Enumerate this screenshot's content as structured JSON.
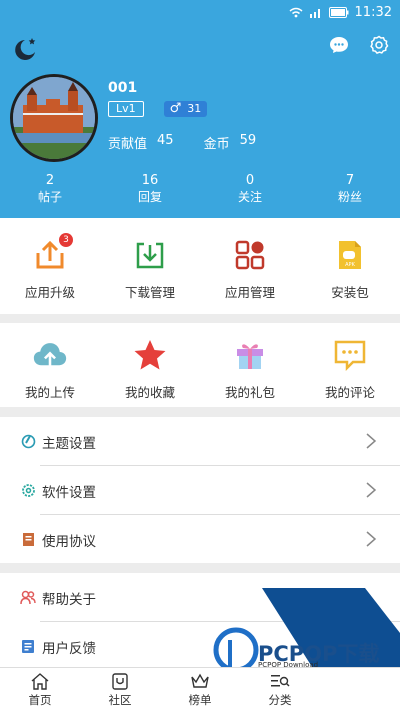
{
  "status": {
    "time": "11:32"
  },
  "profile": {
    "username": "001",
    "level": "Lv1",
    "gender_symbol": "♂",
    "gender_count": "31",
    "contribution_label": "贡献值",
    "contribution_value": "45",
    "coins_label": "金币",
    "coins_value": "59"
  },
  "stats": [
    {
      "value": "2",
      "label": "帖子"
    },
    {
      "value": "16",
      "label": "回复"
    },
    {
      "value": "0",
      "label": "关注"
    },
    {
      "value": "7",
      "label": "粉丝"
    }
  ],
  "grid1": [
    {
      "label": "应用升级",
      "icon": "upgrade-icon",
      "badge": "3"
    },
    {
      "label": "下载管理",
      "icon": "download-icon"
    },
    {
      "label": "应用管理",
      "icon": "apps-icon"
    },
    {
      "label": "安装包",
      "icon": "apk-icon"
    }
  ],
  "grid2": [
    {
      "label": "我的上传",
      "icon": "upload-cloud-icon"
    },
    {
      "label": "我的收藏",
      "icon": "star-icon"
    },
    {
      "label": "我的礼包",
      "icon": "gift-icon"
    },
    {
      "label": "我的评论",
      "icon": "comment-icon"
    }
  ],
  "settings": [
    {
      "label": "主题设置",
      "icon": "palette-icon"
    },
    {
      "label": "软件设置",
      "icon": "gear-icon"
    },
    {
      "label": "使用协议",
      "icon": "document-icon"
    }
  ],
  "more": [
    {
      "label": "帮助关于",
      "icon": "people-icon"
    },
    {
      "label": "用户反馈",
      "icon": "feedback-icon"
    }
  ],
  "nav": [
    {
      "label": "首页",
      "icon": "home-icon"
    },
    {
      "label": "社区",
      "icon": "community-icon"
    },
    {
      "label": "榜单",
      "icon": "crown-icon"
    },
    {
      "label": "分类",
      "icon": "category-icon"
    }
  ],
  "watermark": {
    "brand": "PCPOP下载",
    "sub": "PCPOP Download"
  },
  "colors": {
    "header": "#3aa6de",
    "accent_red": "#e53935",
    "green": "#2e9e4a",
    "orange": "#f08a2c"
  }
}
